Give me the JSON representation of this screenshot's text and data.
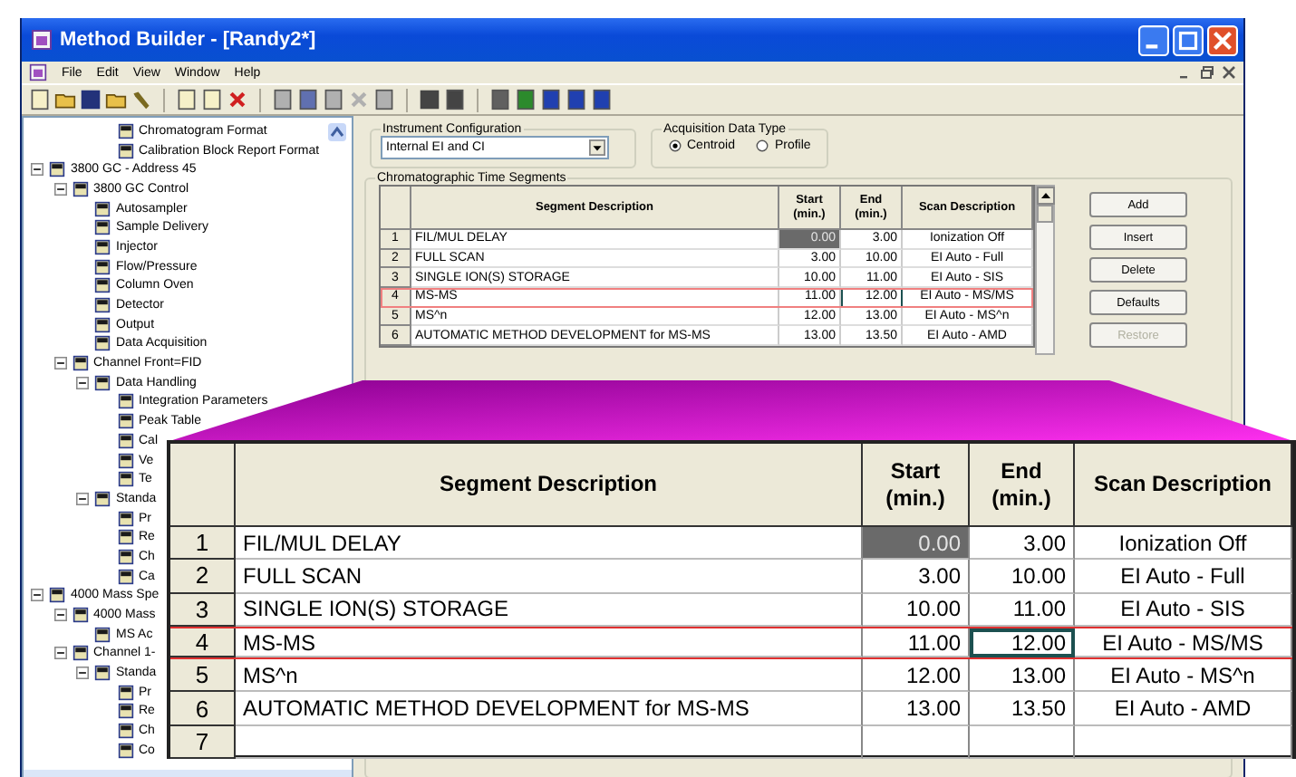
{
  "window": {
    "title": "Method Builder - [Randy2*]"
  },
  "menu": [
    "File",
    "Edit",
    "View",
    "Window",
    "Help"
  ],
  "tree": {
    "partial_items": [
      {
        "label": "Chromatogram Format"
      },
      {
        "label": "Calibration Block Report Format"
      }
    ],
    "items": [
      {
        "label": "3800 GC - Address 45",
        "expanded": true,
        "children": [
          {
            "label": "3800 GC Control",
            "expanded": true,
            "children": [
              {
                "label": "Autosampler"
              },
              {
                "label": "Sample Delivery"
              },
              {
                "label": "Injector"
              },
              {
                "label": "Flow/Pressure"
              },
              {
                "label": "Column Oven"
              },
              {
                "label": "Detector"
              },
              {
                "label": "Output"
              },
              {
                "label": "Data Acquisition"
              }
            ]
          },
          {
            "label": "Channel Front=FID",
            "expanded": true,
            "children": [
              {
                "label": "Data Handling",
                "expanded": true,
                "children": [
                  {
                    "label": "Integration Parameters"
                  },
                  {
                    "label": "Peak Table"
                  },
                  {
                    "label": "Cal"
                  },
                  {
                    "label": "Ve"
                  },
                  {
                    "label": "Te"
                  }
                ]
              },
              {
                "label": "Standa",
                "expanded": true,
                "children": [
                  {
                    "label": "Pr"
                  },
                  {
                    "label": "Re"
                  },
                  {
                    "label": "Ch"
                  },
                  {
                    "label": "Ca"
                  }
                ]
              }
            ]
          }
        ]
      },
      {
        "label": "4000 Mass Spe",
        "expanded": true,
        "children": [
          {
            "label": "4000 Mass",
            "expanded": true,
            "children": [
              {
                "label": "MS Ac"
              }
            ]
          },
          {
            "label": "Channel 1-",
            "expanded": true,
            "children": [
              {
                "label": "Standa",
                "expanded": true,
                "children": [
                  {
                    "label": "Pr"
                  },
                  {
                    "label": "Re"
                  },
                  {
                    "label": "Ch"
                  },
                  {
                    "label": "Co"
                  }
                ]
              }
            ]
          }
        ]
      }
    ]
  },
  "instrument_configuration": {
    "label": "Instrument Configuration",
    "value": "Internal EI and CI"
  },
  "acquisition_data_type": {
    "label": "Acquisition Data Type",
    "options": [
      {
        "label": "Centroid",
        "selected": true
      },
      {
        "label": "Profile",
        "selected": false
      }
    ]
  },
  "segments": {
    "label": "Chromatographic Time Segments",
    "columns": [
      "Segment Description",
      "Start (min.)",
      "End (min.)",
      "Scan Description"
    ],
    "rows": [
      {
        "number": "1",
        "description": "FIL/MUL DELAY",
        "start": "0.00",
        "end": "3.00",
        "scan": "Ionization Off",
        "selected": false,
        "start_disabled": true,
        "end_focused": false
      },
      {
        "number": "2",
        "description": "FULL SCAN",
        "start": "3.00",
        "end": "10.00",
        "scan": "EI Auto - Full",
        "selected": false,
        "start_disabled": false,
        "end_focused": false
      },
      {
        "number": "3",
        "description": "SINGLE ION(S) STORAGE",
        "start": "10.00",
        "end": "11.00",
        "scan": "EI Auto - SIS",
        "selected": false,
        "start_disabled": false,
        "end_focused": false
      },
      {
        "number": "4",
        "description": "MS-MS",
        "start": "11.00",
        "end": "12.00",
        "scan": "EI Auto - MS/MS",
        "selected": true,
        "start_disabled": false,
        "end_focused": true
      },
      {
        "number": "5",
        "description": "MS^n",
        "start": "12.00",
        "end": "13.00",
        "scan": "EI Auto - MS^n",
        "selected": false,
        "start_disabled": false,
        "end_focused": false
      },
      {
        "number": "6",
        "description": "AUTOMATIC METHOD DEVELOPMENT for MS-MS",
        "start": "13.00",
        "end": "13.50",
        "scan": "EI Auto - AMD",
        "selected": false,
        "start_disabled": false,
        "end_focused": false
      }
    ]
  },
  "buttons": [
    {
      "label": "Add",
      "disabled": false
    },
    {
      "label": "Insert",
      "disabled": false
    },
    {
      "label": "Delete",
      "disabled": false
    },
    {
      "label": "Defaults",
      "disabled": false
    },
    {
      "label": "Restore",
      "disabled": true
    }
  ],
  "zoomed_table": {
    "columns": [
      "Segment Description",
      "Start (min.)",
      "End (min.)",
      "Scan Description"
    ],
    "rows": [
      {
        "number": "1",
        "description": "FIL/MUL DELAY",
        "start": "0.00",
        "end": "3.00",
        "scan": "Ionization Off",
        "selected": false,
        "start_disabled": true,
        "end_focused": false
      },
      {
        "number": "2",
        "description": "FULL SCAN",
        "start": "3.00",
        "end": "10.00",
        "scan": "EI Auto - Full",
        "selected": false,
        "start_disabled": false,
        "end_focused": false
      },
      {
        "number": "3",
        "description": "SINGLE ION(S) STORAGE",
        "start": "10.00",
        "end": "11.00",
        "scan": "EI Auto - SIS",
        "selected": false,
        "start_disabled": false,
        "end_focused": false
      },
      {
        "number": "4",
        "description": "MS-MS",
        "start": "11.00",
        "end": "12.00",
        "scan": "EI Auto - MS/MS",
        "selected": true,
        "start_disabled": false,
        "end_focused": true
      },
      {
        "number": "5",
        "description": "MS^n",
        "start": "12.00",
        "end": "13.00",
        "scan": "EI Auto - MS^n",
        "selected": false,
        "start_disabled": false,
        "end_focused": false
      },
      {
        "number": "6",
        "description": "AUTOMATIC METHOD DEVELOPMENT for MS-MS",
        "start": "13.00",
        "end": "13.50",
        "scan": "EI Auto - AMD",
        "selected": false,
        "start_disabled": false,
        "end_focused": false
      },
      {
        "number": "7",
        "selected": false,
        "start_disabled": false,
        "end_focused": false
      }
    ]
  }
}
